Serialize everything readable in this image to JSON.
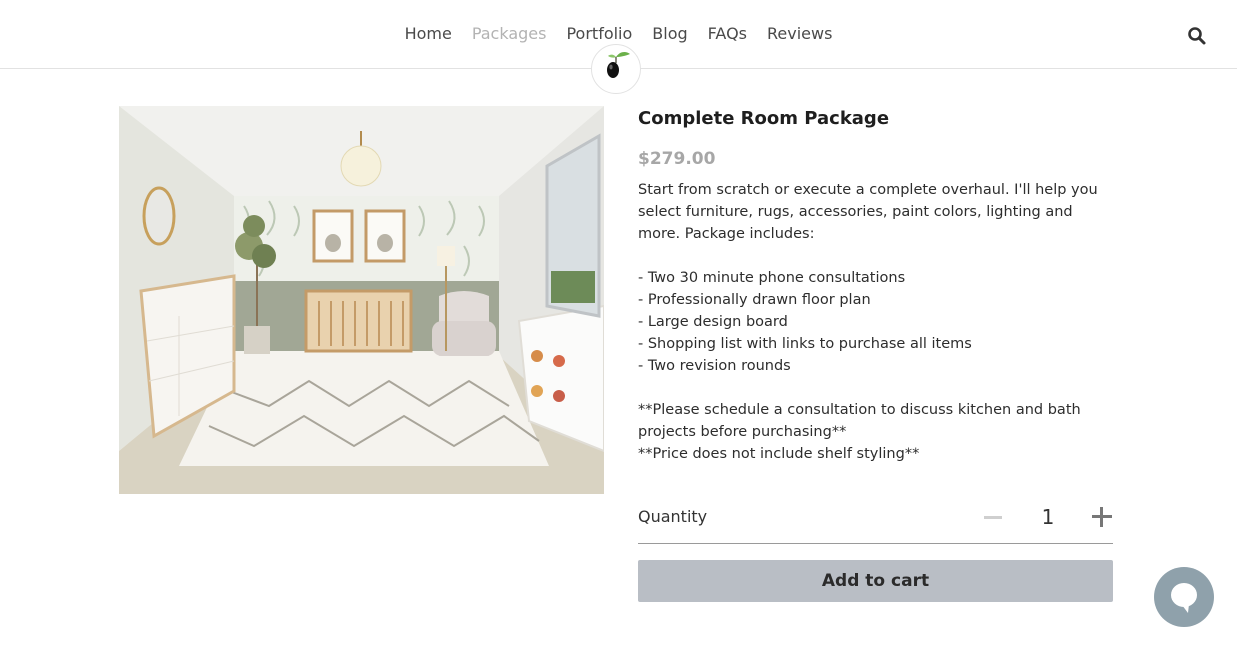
{
  "nav": {
    "items": [
      {
        "label": "Home",
        "active": false
      },
      {
        "label": "Packages",
        "active": true
      },
      {
        "label": "Portfolio",
        "active": false
      },
      {
        "label": "Blog",
        "active": false
      },
      {
        "label": "FAQs",
        "active": false
      },
      {
        "label": "Reviews",
        "active": false
      }
    ],
    "search_icon": "search-icon"
  },
  "logo": {
    "icon": "olive-logo-icon"
  },
  "product": {
    "title": "Complete Room Package",
    "price": "$279.00",
    "description_lines": [
      "Start from scratch or execute a complete overhaul. I'll help you select furniture, rugs, accessories, paint colors, lighting and more. Package includes:",
      "",
      "- Two 30 minute phone consultations",
      "- Professionally drawn floor plan",
      "- Large design board",
      "- Shopping list with links to purchase all items",
      "- Two revision rounds",
      "",
      "**Please schedule a consultation to discuss kitchen and bath projects before purchasing**",
      "**Price does not include shelf styling**"
    ]
  },
  "quantity": {
    "label": "Quantity",
    "value": "1"
  },
  "cart": {
    "add_label": "Add to cart"
  },
  "chat": {
    "icon": "chat-bubble-icon"
  },
  "colors": {
    "price": "#a7a7a7",
    "button_bg": "#b9bec5",
    "chat_bg": "#8fa1ab",
    "nav_active": "#b3b3b3"
  }
}
